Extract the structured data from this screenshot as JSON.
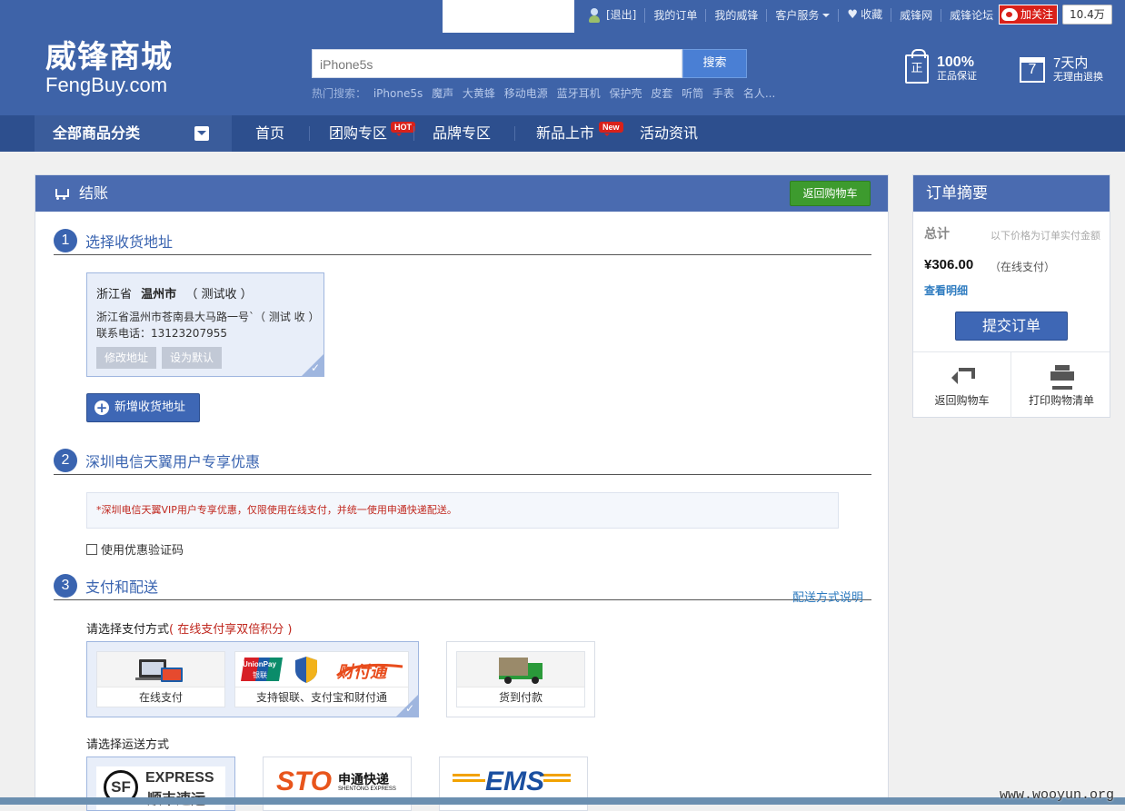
{
  "header": {
    "top_links": [
      "[退出]",
      "我的订单",
      "我的威锋",
      "客户服务",
      "收藏",
      "威锋网",
      "威锋论坛"
    ],
    "weibo_follow": "加关注",
    "weibo_count": "10.4万",
    "logo_cn": "威锋商城",
    "logo_en": "FengBuy.com",
    "search": {
      "value": "iPhone5s",
      "button": "搜索"
    },
    "hot_label": "热门搜索：",
    "hot_words": [
      "iPhone5s",
      "魔声",
      "大黄蜂",
      "移动电源",
      "蓝牙耳机",
      "保护壳",
      "皮套",
      "听筒",
      "手表",
      "名人..."
    ],
    "promise1": {
      "icon_text": "正",
      "big": "100%",
      "small": "正品保证"
    },
    "promise2": {
      "icon_text": "7",
      "big": "7天内",
      "small": "无理由退换"
    }
  },
  "nav": {
    "all_categories": "全部商品分类",
    "items": [
      "首页",
      "团购专区",
      "品牌专区",
      "新品上市",
      "活动资讯"
    ],
    "badge_hot": "HOT",
    "badge_new": "New"
  },
  "checkout": {
    "title": "结账",
    "back_button": "返回购物车",
    "step1": {
      "num": "1",
      "label": "选择收货地址"
    },
    "address": {
      "province": "浙江省",
      "city": "温州市",
      "name": "（ 测试收 ）",
      "detail": "浙江省温州市苍南县大马路一号`（ 测试 收 ）",
      "phone": "联系电话：13123207955",
      "edit_button": "修改地址",
      "default_button": "设为默认"
    },
    "new_address_button": "新增收货地址",
    "step2": {
      "num": "2",
      "label": "深圳电信天翼用户专享优惠"
    },
    "promo_text": "*深圳电信天翼VIP用户专享优惠，仅限使用在线支付，并统一使用申通快递配送。",
    "coupon_label": "使用优惠验证码",
    "step3": {
      "num": "3",
      "label": "支付和配送"
    },
    "shipping_help": "配送方式说明",
    "payment_title": "请选择支付方式",
    "payment_note": "( 在线支付享双倍积分 )",
    "payment_options": {
      "online": "在线支付",
      "bank": "支持银联、支付宝和财付通",
      "cod": "货到付款"
    },
    "pay_logos": {
      "unionpay": "UnionPay",
      "unionpay_cn": "银联",
      "tenpay": "财付通"
    },
    "shipping_title": "请选择运送方式",
    "shipping_options": {
      "sf": {
        "mark": "SF",
        "en": "EXPRESS",
        "cn": "顺丰速运"
      },
      "sto": {
        "mark": "STO",
        "cn": "申通快递",
        "en": "SHENTONG EXPRESS"
      },
      "ems": {
        "mark": "EMS"
      }
    }
  },
  "summary": {
    "title": "订单摘要",
    "total_label": "总计",
    "note": "以下价格为订单实付金额",
    "amount": "¥306.00",
    "amount_note": "（在线支付）",
    "detail_link": "查看明细",
    "submit": "提交订单",
    "back_cart": "返回购物车",
    "print": "打印购物清单"
  },
  "watermark": "www.wooyun.org",
  "colors": {
    "header_bg": "#3e63a8",
    "nav_bg": "#2d4f8e",
    "accent": "#3e67b5",
    "green": "#3d9b2e",
    "red": "#c0281f"
  }
}
